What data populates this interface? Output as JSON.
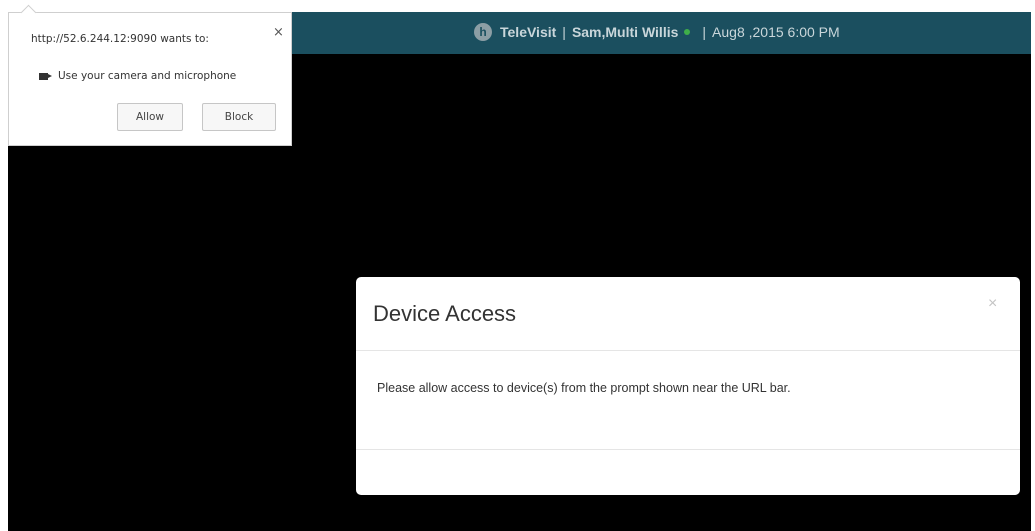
{
  "header": {
    "brand": "TeleVisit",
    "separator": "|",
    "patient": "Sam,Multi Willis",
    "separator2": "|",
    "datetime": "Aug8 ,2015 6:00 PM",
    "status_color": "#3fae49"
  },
  "permission_prompt": {
    "origin_text": "http://52.6.244.12:9090 wants to:",
    "request_text": "Use your camera and microphone",
    "allow_label": "Allow",
    "block_label": "Block",
    "close_symbol": "×",
    "icon": "camera-icon"
  },
  "modal": {
    "title": "Device Access",
    "close_symbol": "×",
    "body": "Please allow access to device(s) from the prompt shown near the URL bar."
  },
  "colors": {
    "topbar": "#1b4f5f",
    "background": "#000000",
    "status": "#3fae49"
  }
}
